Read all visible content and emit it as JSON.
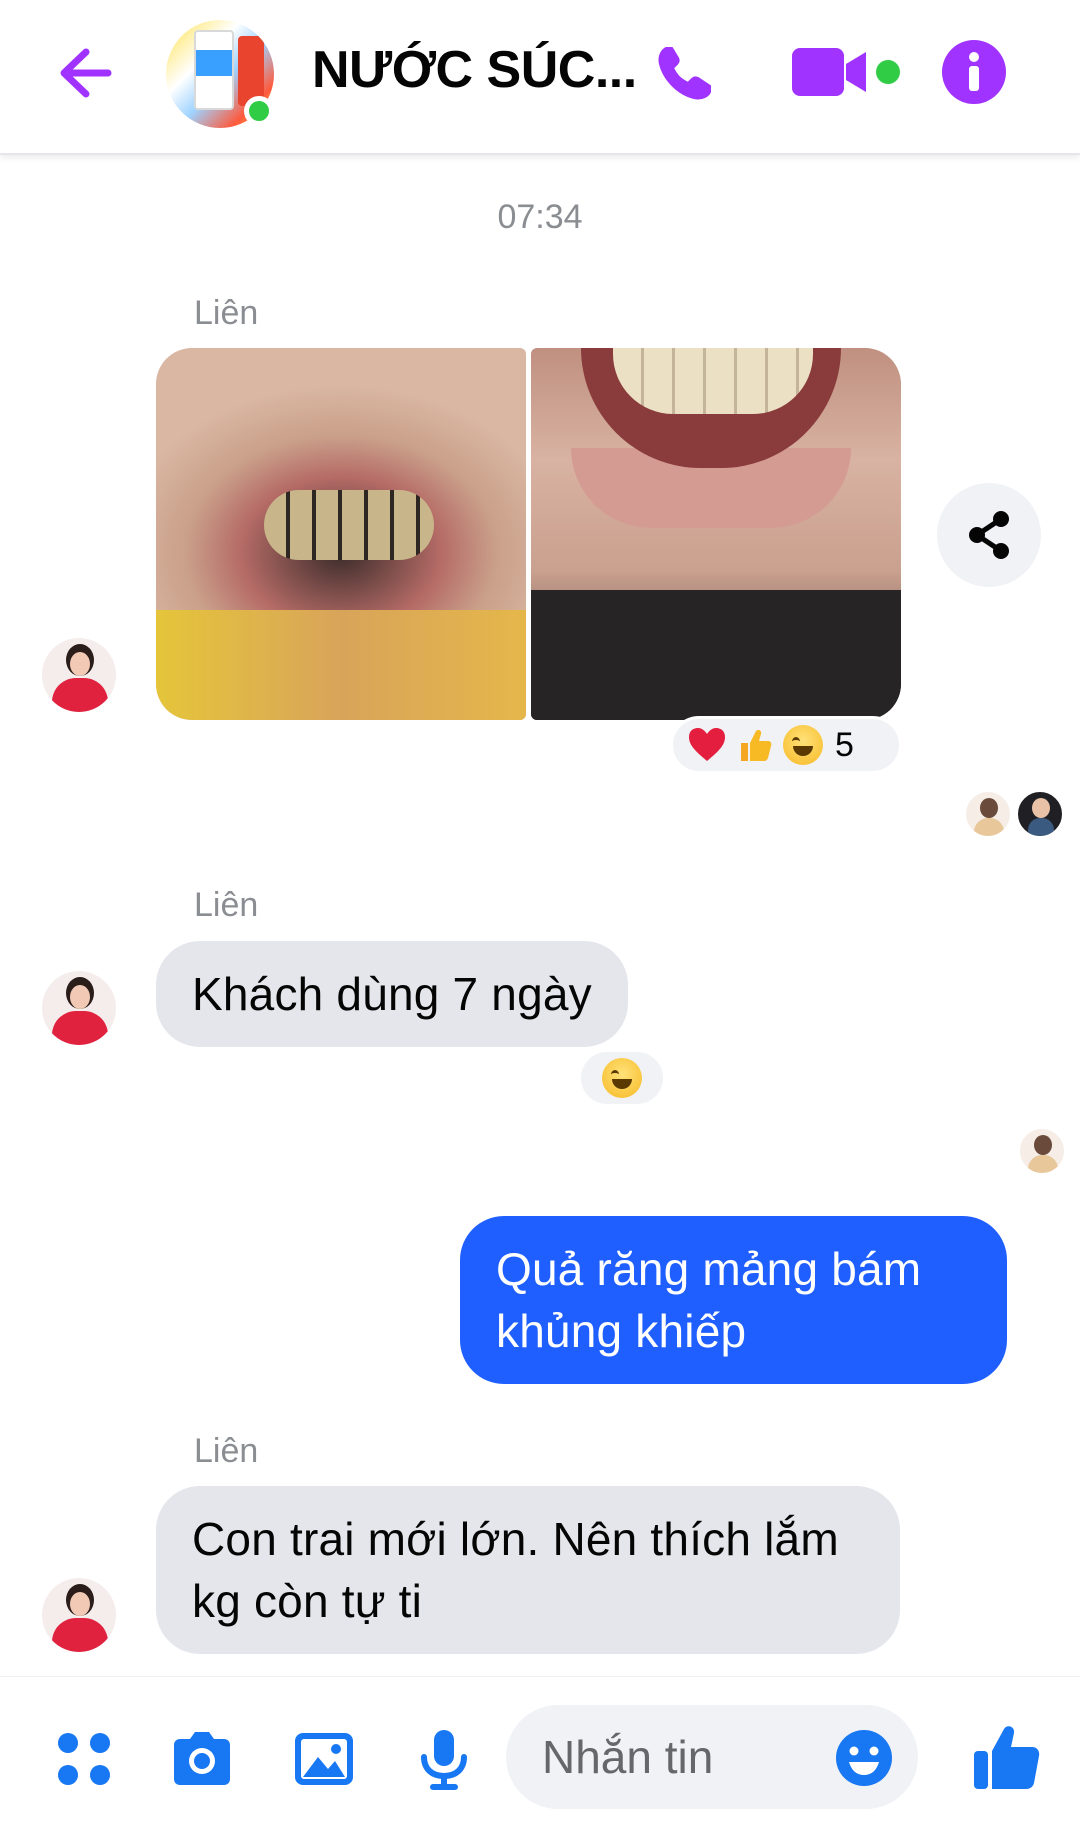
{
  "header": {
    "title": "NƯỚC SÚC...",
    "accent_color": "#a033ff",
    "online_color": "#31cc46",
    "back_icon": "arrow-left-icon",
    "call_icon": "phone-icon",
    "video_icon": "video-camera-icon",
    "info_icon": "info-icon"
  },
  "conversation": {
    "timestamp": "07:34",
    "messages": [
      {
        "sender": "Liên",
        "type": "photos",
        "photo_count": 2,
        "reactions": {
          "emojis": [
            "heart",
            "thumbs-up",
            "laughing"
          ],
          "count": "5"
        },
        "seen_by_count": 2
      },
      {
        "sender": "Liên",
        "type": "text",
        "text": "Khách dùng 7 ngày",
        "reactions": {
          "emojis": [
            "laughing"
          ]
        },
        "seen_by_count": 1
      },
      {
        "sender": "me",
        "type": "text",
        "text": "Quả răng mảng bám khủng khiếp"
      },
      {
        "sender": "Liên",
        "type": "text",
        "text": "Con trai mới lớn. Nên thích lắm kg còn tự ti"
      }
    ]
  },
  "composer": {
    "placeholder": "Nhắn tin",
    "icons": [
      "menu-dots-icon",
      "camera-icon",
      "image-icon",
      "microphone-icon",
      "emoji-icon",
      "thumbs-up-icon"
    ],
    "icon_color": "#1877f2",
    "outgoing_bubble_color": "#1f5fff"
  }
}
